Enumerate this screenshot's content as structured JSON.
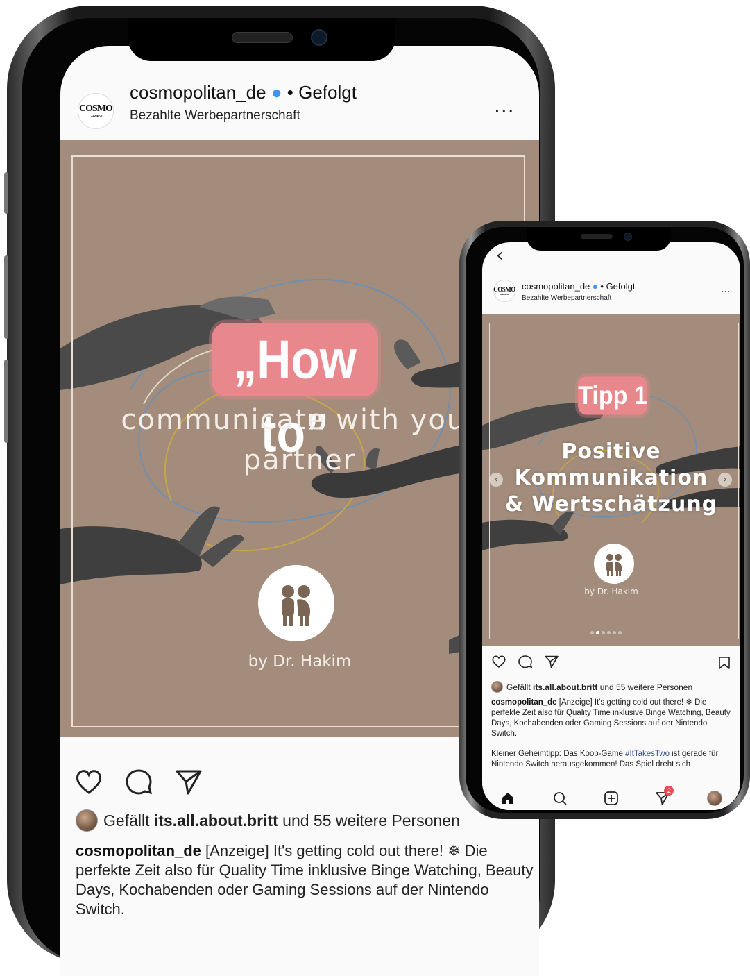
{
  "big": {
    "account": {
      "logo_text": "COSMO",
      "logo_subtext": "GERMANY",
      "handle": "cosmopolitan_de",
      "verified_badge": "●",
      "separator": " • ",
      "follow_status": "Gefolgt",
      "subtitle": "Bezahlte Werbepartnerschaft",
      "more": "..."
    },
    "image": {
      "headline": "„How to”",
      "line1": "communicate with your",
      "line2": "partner",
      "byline": "by Dr. Hakim",
      "slide_count": 6,
      "active_slide": 1
    },
    "likes": {
      "prefix": "Gefällt ",
      "user": "its.all.about.britt",
      "suffix": " und 55 weitere Personen"
    },
    "caption": {
      "user": "cosmopolitan_de",
      "text": " [Anzeige] It's getting cold out there! ❄ Die perfekte Zeit also für Quality Time inklusive Binge Watching, Beauty Days, Kochabenden oder Gaming Sessions auf der Nintendo Switch."
    }
  },
  "small": {
    "back": "‹",
    "account": {
      "logo_text": "COSMO",
      "logo_subtext": "GERMANY",
      "handle": "cosmopolitan_de",
      "verified_badge": "●",
      "separator": " • ",
      "follow_status": "Gefolgt",
      "subtitle": "Bezahlte Werbepartnerschaft",
      "more": "..."
    },
    "image": {
      "headline": "Tipp 1",
      "line1": "Positive",
      "line2": "Kommunikation",
      "line3": "& Wertschätzung",
      "byline": "by Dr. Hakim",
      "prev_arrow": "‹",
      "next_arrow": "›",
      "slide_count": 6,
      "active_slide": 2
    },
    "likes": {
      "prefix": "Gefällt ",
      "user": "its.all.about.britt",
      "suffix": " und 55 weitere Personen"
    },
    "caption": {
      "user": "cosmopolitan_de",
      "text": " [Anzeige] It's getting cold out there! ❄ Die perfekte Zeit also für Quality Time inklusive Binge Watching, Beauty Days, Kochabenden oder Gaming Sessions auf der Nintendo Switch.",
      "p2_prefix": "Kleiner Geheimtipp: Das Koop-Game ",
      "p2_tag": "#ItTakesTwo",
      "p2_suffix": " ist gerade für Nintendo Switch herausgekommen! Das Spiel dreht sich"
    },
    "tabbar": {
      "notification_count": "2"
    }
  },
  "colors": {
    "image_bg": "#a38c7b",
    "accent_pink": "#e9888c",
    "verified_blue": "#3897f0",
    "notification_red": "#ed4956"
  },
  "icons": [
    "heart-icon",
    "comment-icon",
    "share-icon",
    "bookmark-icon",
    "home-icon",
    "search-icon",
    "add-icon",
    "activity-icon"
  ]
}
